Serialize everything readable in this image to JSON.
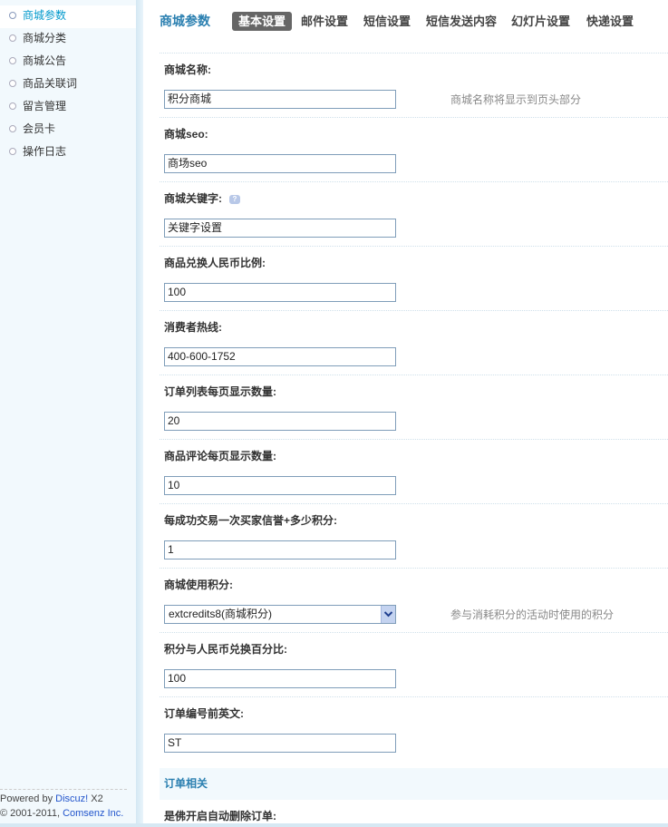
{
  "sidebar": {
    "items": [
      {
        "label": "商城参数",
        "active": true
      },
      {
        "label": "商城分类",
        "active": false
      },
      {
        "label": "商城公告",
        "active": false
      },
      {
        "label": "商品关联词",
        "active": false
      },
      {
        "label": "留言管理",
        "active": false
      },
      {
        "label": "会员卡",
        "active": false
      },
      {
        "label": "操作日志",
        "active": false
      }
    ],
    "footer": {
      "powered_prefix": "Powered by ",
      "powered_link": "Discuz!",
      "powered_suffix": " X2",
      "copyright_prefix": "© 2001-2011, ",
      "copyright_link": "Comsenz Inc."
    }
  },
  "header": {
    "title": "商城参数",
    "tabs": [
      "基本设置",
      "邮件设置",
      "短信设置",
      "短信发送内容",
      "幻灯片设置",
      "快递设置"
    ],
    "active_tab": 0
  },
  "form": {
    "shop_name": {
      "label": "商城名称:",
      "value": "积分商城",
      "tip": "商城名称将显示到页头部分"
    },
    "shop_seo": {
      "label": "商城seo:",
      "value": "商场seo"
    },
    "shop_keywords": {
      "label": "商城关键字:",
      "value": "关键字设置",
      "help_icon": "question-icon"
    },
    "exchange_ratio": {
      "label": "商品兑换人民币比例:",
      "value": "100"
    },
    "hotline": {
      "label": "消费者热线:",
      "value": "400-600-1752"
    },
    "orders_per_page": {
      "label": "订单列表每页显示数量:",
      "value": "20"
    },
    "reviews_per_page": {
      "label": "商品评论每页显示数量:",
      "value": "10"
    },
    "credit_per_trade": {
      "label": "每成功交易一次买家信誉+多少积分:",
      "value": "1"
    },
    "shop_credit": {
      "label": "商城使用积分:",
      "value": "extcredits8(商城积分)",
      "tip": "参与消耗积分的活动时使用的积分"
    },
    "credit_percent": {
      "label": "积分与人民币兑换百分比:",
      "value": "100"
    },
    "order_prefix": {
      "label": "订单编号前英文:",
      "value": "ST"
    }
  },
  "order_section": {
    "title": "订单相关",
    "auto_delete_label": "是佛开启自动删除订单:"
  }
}
